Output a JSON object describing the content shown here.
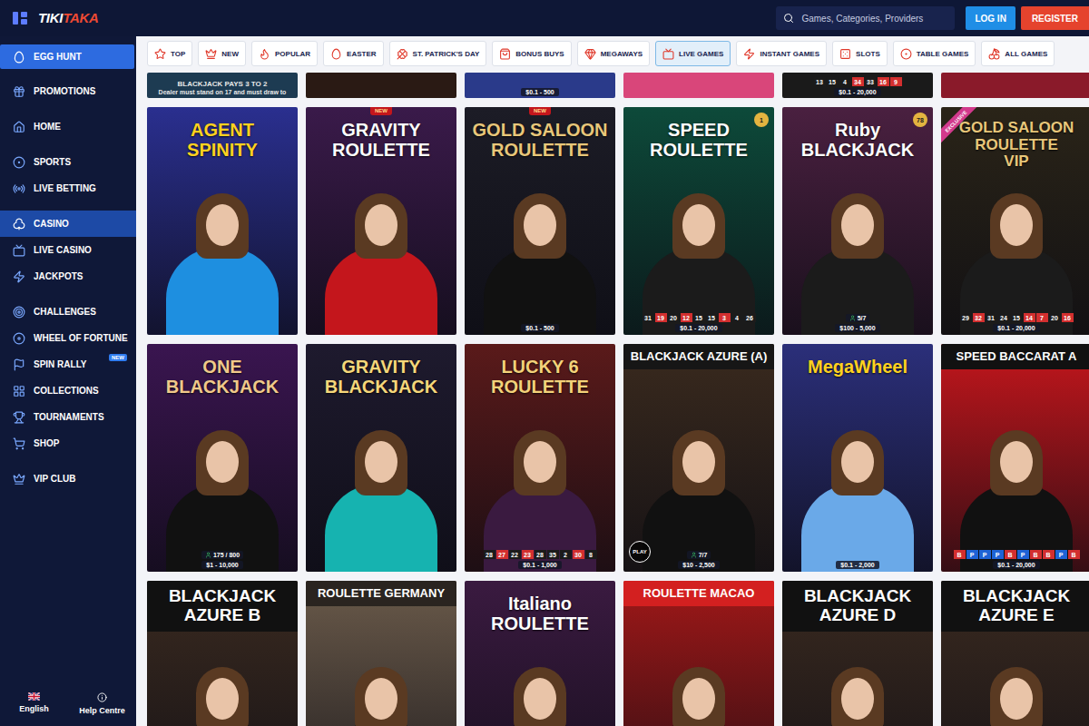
{
  "header": {
    "logo": [
      "TIKI",
      "TAKA"
    ],
    "search": {
      "placeholder": "Games, Categories, Providers"
    },
    "buttons": [
      {
        "label": "LOG IN",
        "kind": "login"
      },
      {
        "label": "REGISTER",
        "kind": "register"
      }
    ]
  },
  "sidebar": {
    "groups": [
      [
        {
          "label": "EGG HUNT",
          "selected": false,
          "featured": true
        }
      ],
      [
        {
          "label": "PROMOTIONS",
          "selected": false,
          "featured": false
        }
      ],
      [
        {
          "label": "HOME",
          "selected": false,
          "featured": false
        }
      ],
      [
        {
          "label": "SPORTS",
          "selected": false,
          "featured": false
        },
        {
          "label": "LIVE BETTING",
          "selected": false,
          "featured": false
        }
      ],
      [
        {
          "label": "CASINO",
          "selected": true,
          "featured": false
        },
        {
          "label": "LIVE CASINO",
          "selected": false,
          "featured": false
        },
        {
          "label": "JACKPOTS",
          "selected": false,
          "featured": false
        }
      ],
      [
        {
          "label": "CHALLENGES",
          "selected": false,
          "featured": false
        },
        {
          "label": "WHEEL OF FORTUNE",
          "selected": false,
          "featured": false
        },
        {
          "label": "SPIN RALLY",
          "selected": false,
          "featured": false,
          "badge": "NEW"
        },
        {
          "label": "COLLECTIONS",
          "selected": false,
          "featured": false
        },
        {
          "label": "TOURNAMENTS",
          "selected": false,
          "featured": false
        },
        {
          "label": "SHOP",
          "selected": false,
          "featured": false
        }
      ],
      [
        {
          "label": "VIP CLUB",
          "selected": false,
          "featured": false
        }
      ]
    ],
    "footer": [
      {
        "label": "English",
        "kind": "language"
      },
      {
        "label": "Help Centre",
        "kind": "help"
      }
    ]
  },
  "categories": [
    {
      "label": "TOP",
      "selected": false
    },
    {
      "label": "NEW",
      "selected": false
    },
    {
      "label": "POPULAR",
      "selected": false
    },
    {
      "label": "EASTER",
      "selected": false
    },
    {
      "label": "ST. PATRICK'S DAY",
      "selected": false
    },
    {
      "label": "BONUS BUYS",
      "selected": false
    },
    {
      "label": "MEGAWAYS",
      "selected": false
    },
    {
      "label": "LIVE GAMES",
      "selected": true
    },
    {
      "label": "INSTANT GAMES",
      "selected": false
    },
    {
      "label": "SLOTS",
      "selected": false
    },
    {
      "label": "TABLE GAMES",
      "selected": false
    },
    {
      "label": "ALL GAMES",
      "selected": false
    }
  ],
  "games": {
    "partial_row": [
      {
        "color": "#1d3b52",
        "lines": [
          "BLACKJACK PAYS 3 TO 2",
          "Dealer must stand on 17 and must draw to"
        ]
      },
      {
        "color": "#2a1a14"
      },
      {
        "color": "#2a3a8a",
        "limits": "$0.1 - 500"
      },
      {
        "color": "#d9467a"
      },
      {
        "color": "#1a1a1a",
        "results": [
          {
            "value": "13",
            "color": "#1b1b1b"
          },
          {
            "value": "15",
            "color": "#1b1b1b"
          },
          {
            "value": "4",
            "color": "#1b1b1b"
          },
          {
            "value": "34",
            "color": "#d32f2f"
          },
          {
            "value": "33",
            "color": "#1b1b1b"
          },
          {
            "value": "16",
            "color": "#d32f2f"
          },
          {
            "value": "9",
            "color": "#d32f2f"
          }
        ],
        "limits": "$0.1 - 20,000"
      },
      {
        "color": "#8a1a2a"
      }
    ],
    "rows": [
      [
        {
          "kind": "logo",
          "title": [
            "AGENT",
            "SPINITY"
          ],
          "color": "#2a2f8f",
          "title_color": "#ffd21f",
          "outfit": "#1e8fe0"
        },
        {
          "kind": "logo",
          "title": [
            "GRAVITY",
            "ROULETTE"
          ],
          "color": "#3a1a4a",
          "title_color": "#ffffff",
          "outfit": "#c4161c",
          "badge": {
            "text": "NEW",
            "kind": "new"
          }
        },
        {
          "kind": "logo",
          "title": [
            "GOLD SALOON",
            "ROULETTE"
          ],
          "color": "#1c1c26",
          "title_color": "#e8c77a",
          "outfit": "#111111",
          "badge": {
            "text": "NEW",
            "kind": "new"
          },
          "limits": "$0.1 - 500"
        },
        {
          "kind": "logo",
          "title": [
            "SPEED",
            "ROULETTE"
          ],
          "color": "#0d4a3a",
          "title_color": "#ffffff",
          "outfit": "#1b1b1b",
          "badge": {
            "text": "1",
            "kind": "count"
          },
          "results": [
            {
              "value": "31",
              "color": "#1b1b1b"
            },
            {
              "value": "19",
              "color": "#d32f2f"
            },
            {
              "value": "20",
              "color": "#1b1b1b"
            },
            {
              "value": "12",
              "color": "#d32f2f"
            },
            {
              "value": "15",
              "color": "#1b1b1b"
            },
            {
              "value": "15",
              "color": "#1b1b1b"
            },
            {
              "value": "3",
              "color": "#d32f2f"
            },
            {
              "value": "4",
              "color": "#1b1b1b"
            },
            {
              "value": "26",
              "color": "#1b1b1b"
            }
          ],
          "limits": "$0.1 - 20,000"
        },
        {
          "kind": "logo",
          "title": [
            "Ruby",
            "BLACKJACK"
          ],
          "color": "#4a2040",
          "title_color": "#ffffff",
          "outfit": "#1b1b1b",
          "badge": {
            "text": "78",
            "kind": "count"
          },
          "players": "5/7",
          "limits": "$100 - 5,000"
        },
        {
          "kind": "logo",
          "title": [
            "GOLD SALOON",
            "ROULETTE",
            "VIP"
          ],
          "color": "#2a2418",
          "title_color": "#e8c77a",
          "outfit": "#1b1b1b",
          "badge": {
            "text": "EXCLUSIVE",
            "kind": "ribbon"
          },
          "results": [
            {
              "value": "29",
              "color": "#1b1b1b"
            },
            {
              "value": "32",
              "color": "#d32f2f"
            },
            {
              "value": "31",
              "color": "#1b1b1b"
            },
            {
              "value": "24",
              "color": "#1b1b1b"
            },
            {
              "value": "15",
              "color": "#1b1b1b"
            },
            {
              "value": "14",
              "color": "#d32f2f"
            },
            {
              "value": "7",
              "color": "#d32f2f"
            },
            {
              "value": "20",
              "color": "#1b1b1b"
            },
            {
              "value": "16",
              "color": "#d32f2f"
            }
          ],
          "limits": "$0.1 - 20,000"
        }
      ],
      [
        {
          "kind": "logo",
          "title": [
            "ONE",
            "BLACKJACK"
          ],
          "color": "#3a1550",
          "title_color": "#f0c98a",
          "outfit": "#111111",
          "players": "175 / 800",
          "limits": "$1 - 10,000"
        },
        {
          "kind": "logo",
          "title": [
            "GRAVITY",
            "BLACKJACK"
          ],
          "color": "#1e1a2e",
          "title_color": "#f5d77a",
          "outfit": "#16b3b0"
        },
        {
          "kind": "logo",
          "title": [
            "LUCKY 6",
            "ROULETTE"
          ],
          "color": "#5a1a1a",
          "title_color": "#f3d27a",
          "outfit": "#3a1a40",
          "results": [
            {
              "value": "28",
              "color": "#1b1b1b"
            },
            {
              "value": "27",
              "color": "#d32f2f"
            },
            {
              "value": "22",
              "color": "#1b1b1b"
            },
            {
              "value": "23",
              "color": "#d32f2f"
            },
            {
              "value": "28",
              "color": "#1b1b1b"
            },
            {
              "value": "35",
              "color": "#1b1b1b"
            },
            {
              "value": "2",
              "color": "#1b1b1b"
            },
            {
              "value": "30",
              "color": "#d32f2f"
            },
            {
              "value": "8",
              "color": "#1b1b1b"
            }
          ],
          "limits": "$0.1 - 1,000"
        },
        {
          "kind": "band",
          "title": [
            "BLACKJACK AZURE (A)"
          ],
          "color": "#3a2a1e",
          "band": "#161616",
          "title_color": "#ffffff",
          "outfit": "#111111",
          "players": "7/7",
          "limits": "$10 - 2,500",
          "play": "PLAY"
        },
        {
          "kind": "logo",
          "title": [
            "MegaWheel"
          ],
          "color": "#2b2f7a",
          "title_color": "#ffd21f",
          "outfit": "#6aa9e8",
          "limits": "$0.1 - 2,000"
        },
        {
          "kind": "band",
          "title": [
            "SPEED BACCARAT A"
          ],
          "color": "#c4161c",
          "band": "#111111",
          "title_color": "#ffffff",
          "outfit": "#111111",
          "results": [
            {
              "value": "B",
              "color": "#d32f2f"
            },
            {
              "value": "P",
              "color": "#1e63d6"
            },
            {
              "value": "P",
              "color": "#1e63d6"
            },
            {
              "value": "P",
              "color": "#1e63d6"
            },
            {
              "value": "B",
              "color": "#d32f2f"
            },
            {
              "value": "P",
              "color": "#1e63d6"
            },
            {
              "value": "B",
              "color": "#d32f2f"
            },
            {
              "value": "B",
              "color": "#d32f2f"
            },
            {
              "value": "P",
              "color": "#1e63d6"
            },
            {
              "value": "B",
              "color": "#d32f2f"
            }
          ],
          "limits": "$0.1 - 20,000"
        }
      ],
      [
        {
          "kind": "band",
          "title": [
            "BLACKJACK",
            "AZURE B"
          ],
          "color": "#3a2a20",
          "band": "#111111",
          "title_color": "#ffffff",
          "outfit": "#111111"
        },
        {
          "kind": "band",
          "title": [
            "ROULETTE GERMANY"
          ],
          "color": "#6a5a4a",
          "band": "#2a2420",
          "title_color": "#ffffff",
          "outfit": "#111111"
        },
        {
          "kind": "logo",
          "title": [
            "Italiano",
            "ROULETTE"
          ],
          "color": "#3a1a40",
          "title_color": "#ffffff",
          "outfit": "#111111"
        },
        {
          "kind": "band",
          "title": [
            "ROULETTE MACAO"
          ],
          "color": "#a01818",
          "band": "#d32020",
          "title_color": "#ffffff",
          "outfit": "#111111"
        },
        {
          "kind": "band",
          "title": [
            "BLACKJACK",
            "AZURE D"
          ],
          "color": "#3a2a20",
          "band": "#111111",
          "title_color": "#ffffff",
          "outfit": "#111111"
        },
        {
          "kind": "band",
          "title": [
            "BLACKJACK",
            "AZURE E"
          ],
          "color": "#3a2a20",
          "band": "#111111",
          "title_color": "#ffffff",
          "outfit": "#111111"
        }
      ]
    ]
  }
}
